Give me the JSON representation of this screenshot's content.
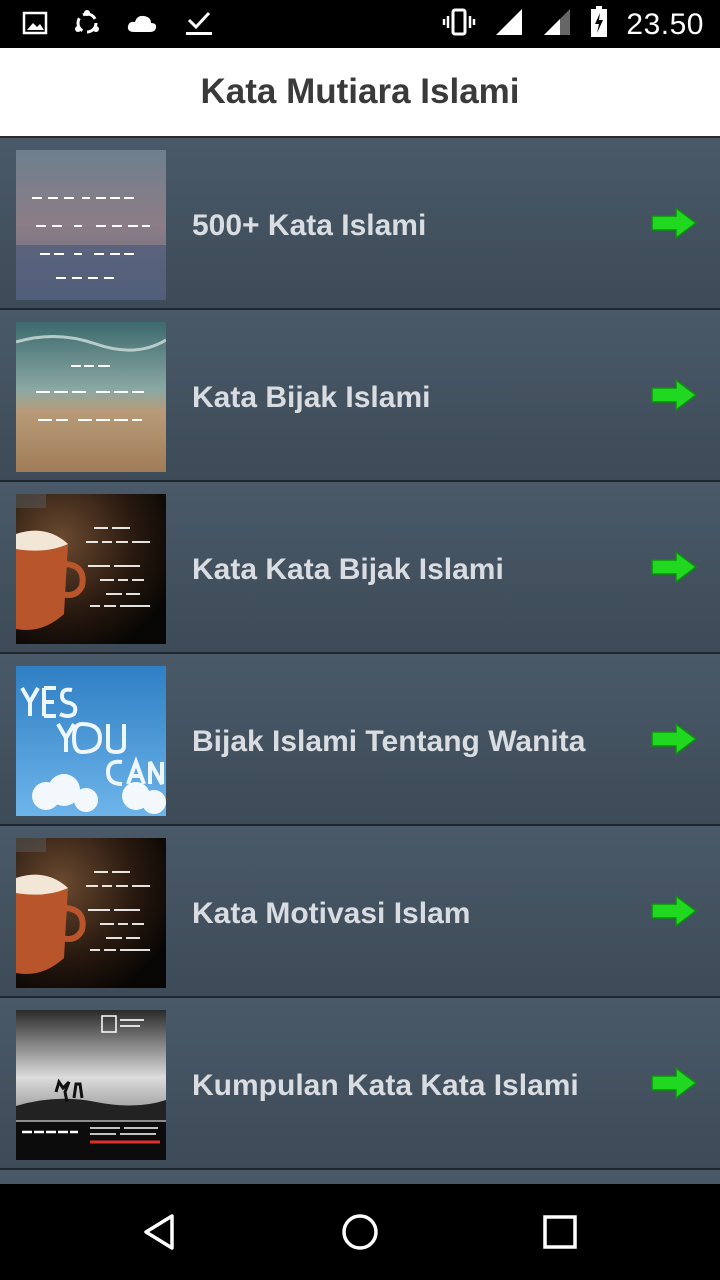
{
  "status_bar": {
    "time": "23.50",
    "left_icons": [
      "image-icon",
      "sync-icon",
      "cloud-icon",
      "download-done-icon"
    ],
    "right_icons": [
      "vibrate-icon",
      "signal-icon",
      "signal-icon",
      "battery-charging-icon"
    ]
  },
  "app_bar": {
    "title": "Kata Mutiara Islami"
  },
  "list": {
    "items": [
      {
        "label": "500+ Kata Islami",
        "thumb_text": "OPEN YOUR MIND BEFORE OPEN YOUR MOUTH..."
      },
      {
        "label": "Kata Bijak Islami",
        "thumb_text": "5000+ kumpulan Kata kata Motivasi"
      },
      {
        "label": "Kata Kata Bijak Islami",
        "thumb_text": "Boleh pasrak, tapi gak boleh nyerah. Bukankah masalah malah jadi makin susah jika kita menyerah?"
      },
      {
        "label": "Bijak Islami Tentang Wanita",
        "thumb_text": "YES YOU CAN"
      },
      {
        "label": "Kata Motivasi Islam",
        "thumb_text": "Boleh pasrak, tapi gak boleh nyerah. Bukankah masalah malah jadi makin susah jika kita menyerah?"
      },
      {
        "label": "Kumpulan Kata Kata Islami",
        "thumb_text": "SAHABAT MENJATUHKANMU"
      }
    ]
  },
  "colors": {
    "row_bg": "#3e4d5b",
    "arrow": "#1fd81f",
    "label": "#d9dde2",
    "title": "#3a3a3a"
  },
  "nav_bar": {
    "icons": [
      "back-icon",
      "home-icon",
      "recents-icon"
    ]
  }
}
